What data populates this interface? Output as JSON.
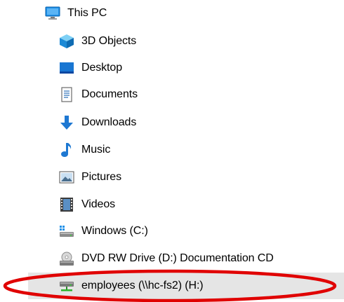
{
  "tree": {
    "root": {
      "label": "This PC",
      "icon": "computer-icon"
    },
    "items": [
      {
        "label": "3D Objects",
        "icon": "3d-objects-icon"
      },
      {
        "label": "Desktop",
        "icon": "desktop-icon"
      },
      {
        "label": "Documents",
        "icon": "documents-icon"
      },
      {
        "label": "Downloads",
        "icon": "downloads-icon"
      },
      {
        "label": "Music",
        "icon": "music-icon"
      },
      {
        "label": "Pictures",
        "icon": "pictures-icon"
      },
      {
        "label": "Videos",
        "icon": "videos-icon"
      },
      {
        "label": "Windows (C:)",
        "icon": "windows-drive-icon"
      },
      {
        "label": "DVD RW Drive (D:) Documentation CD",
        "icon": "dvd-drive-icon"
      },
      {
        "label": "employees (\\\\hc-fs2) (H:)",
        "icon": "network-drive-icon",
        "selected": true
      }
    ]
  },
  "highlight": {
    "color": "#e00000",
    "icon": "red-oval-annotation"
  },
  "colors": {
    "selection": "#e5e5e5",
    "accent": "#0078d7"
  }
}
